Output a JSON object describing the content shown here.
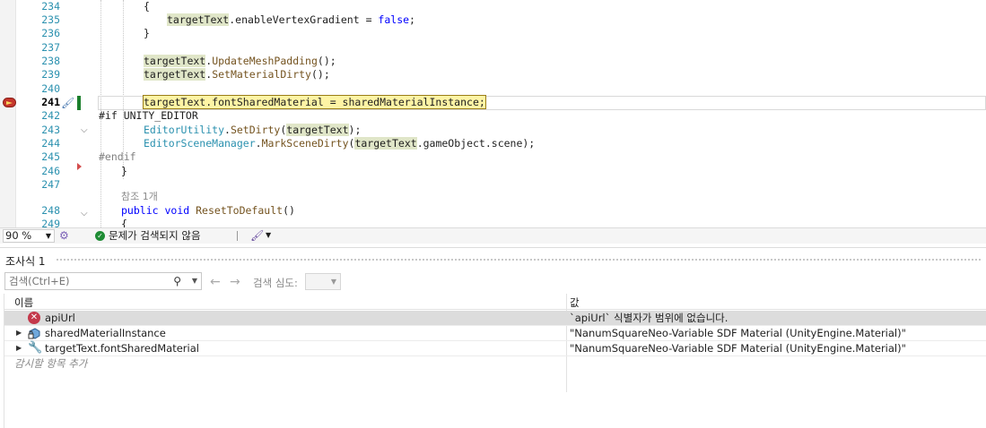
{
  "editor": {
    "lines": [
      {
        "num": "234",
        "parts": [
          {
            "t": "{",
            "c": ""
          }
        ]
      },
      {
        "num": "235",
        "parts": [
          {
            "t": "targetText",
            "c": "id"
          },
          {
            "t": ".enableVertexGradient = ",
            "c": ""
          },
          {
            "t": "false",
            "c": "k"
          },
          {
            "t": ";",
            "c": ""
          }
        ]
      },
      {
        "num": "236",
        "parts": [
          {
            "t": "}",
            "c": ""
          }
        ]
      },
      {
        "num": "237",
        "parts": []
      },
      {
        "num": "238",
        "parts": [
          {
            "t": "targetText",
            "c": "id"
          },
          {
            "t": ".",
            "c": ""
          },
          {
            "t": "UpdateMeshPadding",
            "c": "m"
          },
          {
            "t": "();",
            "c": ""
          }
        ]
      },
      {
        "num": "239",
        "parts": [
          {
            "t": "targetText",
            "c": "id"
          },
          {
            "t": ".",
            "c": ""
          },
          {
            "t": "SetMaterialDirty",
            "c": "m"
          },
          {
            "t": "();",
            "c": ""
          }
        ]
      },
      {
        "num": "240",
        "parts": []
      },
      {
        "num": "241",
        "parts": [
          {
            "t": "targetText.fontSharedMaterial = sharedMaterialInstance;",
            "c": "stmt"
          }
        ]
      },
      {
        "num": "242",
        "parts": [
          {
            "t": "#if UNITY_EDITOR",
            "c": ""
          }
        ]
      },
      {
        "num": "243",
        "parts": [
          {
            "t": "EditorUtility",
            "c": "t"
          },
          {
            "t": ".",
            "c": ""
          },
          {
            "t": "SetDirty",
            "c": "m"
          },
          {
            "t": "(",
            "c": ""
          },
          {
            "t": "targetText",
            "c": "id"
          },
          {
            "t": ");",
            "c": ""
          }
        ]
      },
      {
        "num": "244",
        "parts": [
          {
            "t": "EditorSceneManager",
            "c": "t"
          },
          {
            "t": ".",
            "c": ""
          },
          {
            "t": "MarkSceneDirty",
            "c": "m"
          },
          {
            "t": "(",
            "c": ""
          },
          {
            "t": "targetText",
            "c": "id"
          },
          {
            "t": ".gameObject.scene);",
            "c": ""
          }
        ]
      },
      {
        "num": "245",
        "parts": [
          {
            "t": "#endif",
            "c": "pp"
          }
        ]
      },
      {
        "num": "246",
        "parts": [
          {
            "t": "}",
            "c": ""
          }
        ]
      },
      {
        "num": "247",
        "parts": []
      },
      {
        "num": "",
        "parts": [
          {
            "t": "참조 1개",
            "c": "cl"
          }
        ]
      },
      {
        "num": "248",
        "parts": [
          {
            "t": "public",
            "c": "k"
          },
          {
            "t": " ",
            "c": ""
          },
          {
            "t": "void",
            "c": "k"
          },
          {
            "t": " ",
            "c": ""
          },
          {
            "t": "ResetToDefault",
            "c": "m"
          },
          {
            "t": "()",
            "c": ""
          }
        ]
      },
      {
        "num": "249",
        "parts": [
          {
            "t": "{",
            "c": ""
          }
        ]
      }
    ]
  },
  "status": {
    "zoom": "90 %",
    "issues": "문제가 검색되지 않음"
  },
  "watch": {
    "title": "조사식 1",
    "search_placeholder": "검색(Ctrl+E)",
    "depth_label": "검색 심도:",
    "col_name": "이름",
    "col_value": "값",
    "rows": [
      {
        "name": "apiUrl",
        "value": "`apiUrl` 식별자가 범위에 없습니다."
      },
      {
        "name": "sharedMaterialInstance",
        "value": "\"NanumSquareNeo-Variable SDF Material (UnityEngine.Material)\""
      },
      {
        "name": "targetText.fontSharedMaterial",
        "value": "\"NanumSquareNeo-Variable SDF Material (UnityEngine.Material)\""
      }
    ],
    "add_item": "감시할 항목 추가"
  }
}
